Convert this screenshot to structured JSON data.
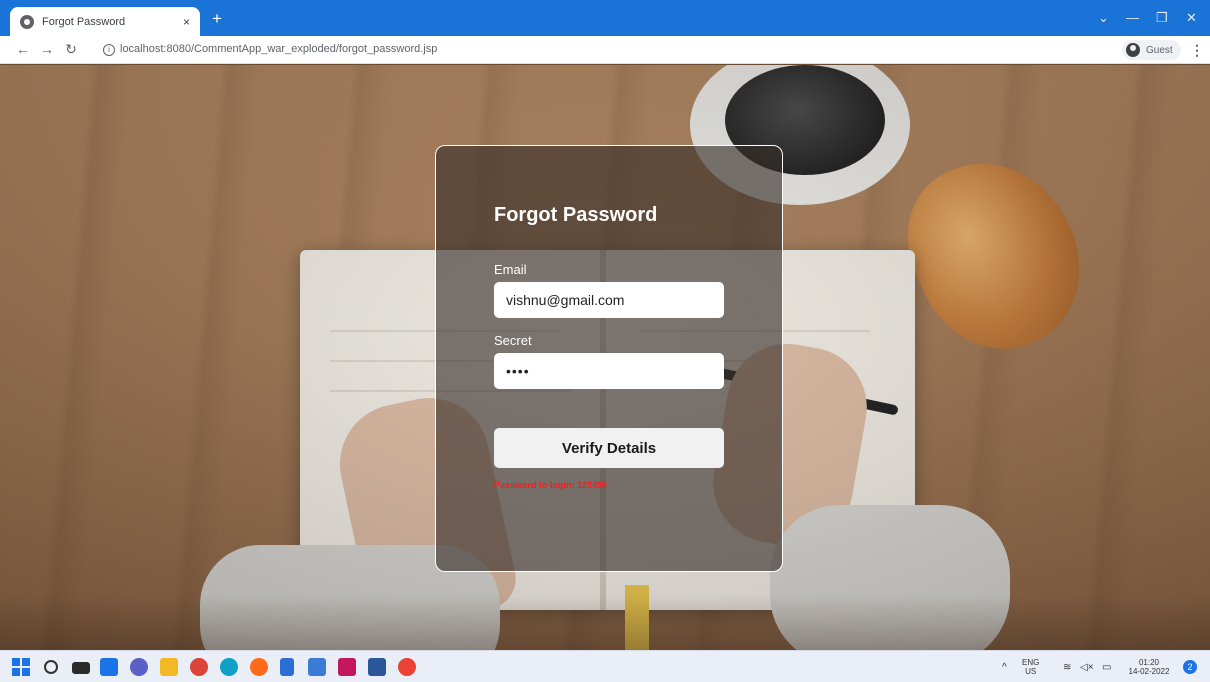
{
  "browser": {
    "tab_title": "Forgot Password",
    "tab_close": "×",
    "new_tab": "+",
    "url": "localhost:8080/CommentApp_war_exploded/forgot_password.jsp",
    "profile_label": "Guest",
    "win_min": "—",
    "win_restore": "❐",
    "win_close": "✕",
    "win_collapse": "⌄"
  },
  "form": {
    "title": "Forgot Password",
    "email_label": "Email",
    "email_value": "vishnu@gmail.com",
    "secret_label": "Secret",
    "secret_value": "••••",
    "submit_label": "Verify Details",
    "error_message": "Password to login: 123456"
  },
  "taskbar": {
    "lang_top": "ENG",
    "lang_bottom": "US",
    "time": "01:20",
    "date": "14-02-2022",
    "notification_count": "2",
    "icons": [
      "windows-start-icon",
      "search-icon",
      "task-view-icon",
      "widgets-icon",
      "chat-icon",
      "file-explorer-icon",
      "chrome-icon",
      "edge-icon",
      "firefox-icon",
      "notepad-icon",
      "photos-icon",
      "intellij-icon",
      "word-icon",
      "chrome-icon-2"
    ]
  },
  "colors": {
    "tabbar": "#1a73d6",
    "card_overlay": "rgba(55,45,40,0.62)",
    "error": "#ff1a1a"
  }
}
